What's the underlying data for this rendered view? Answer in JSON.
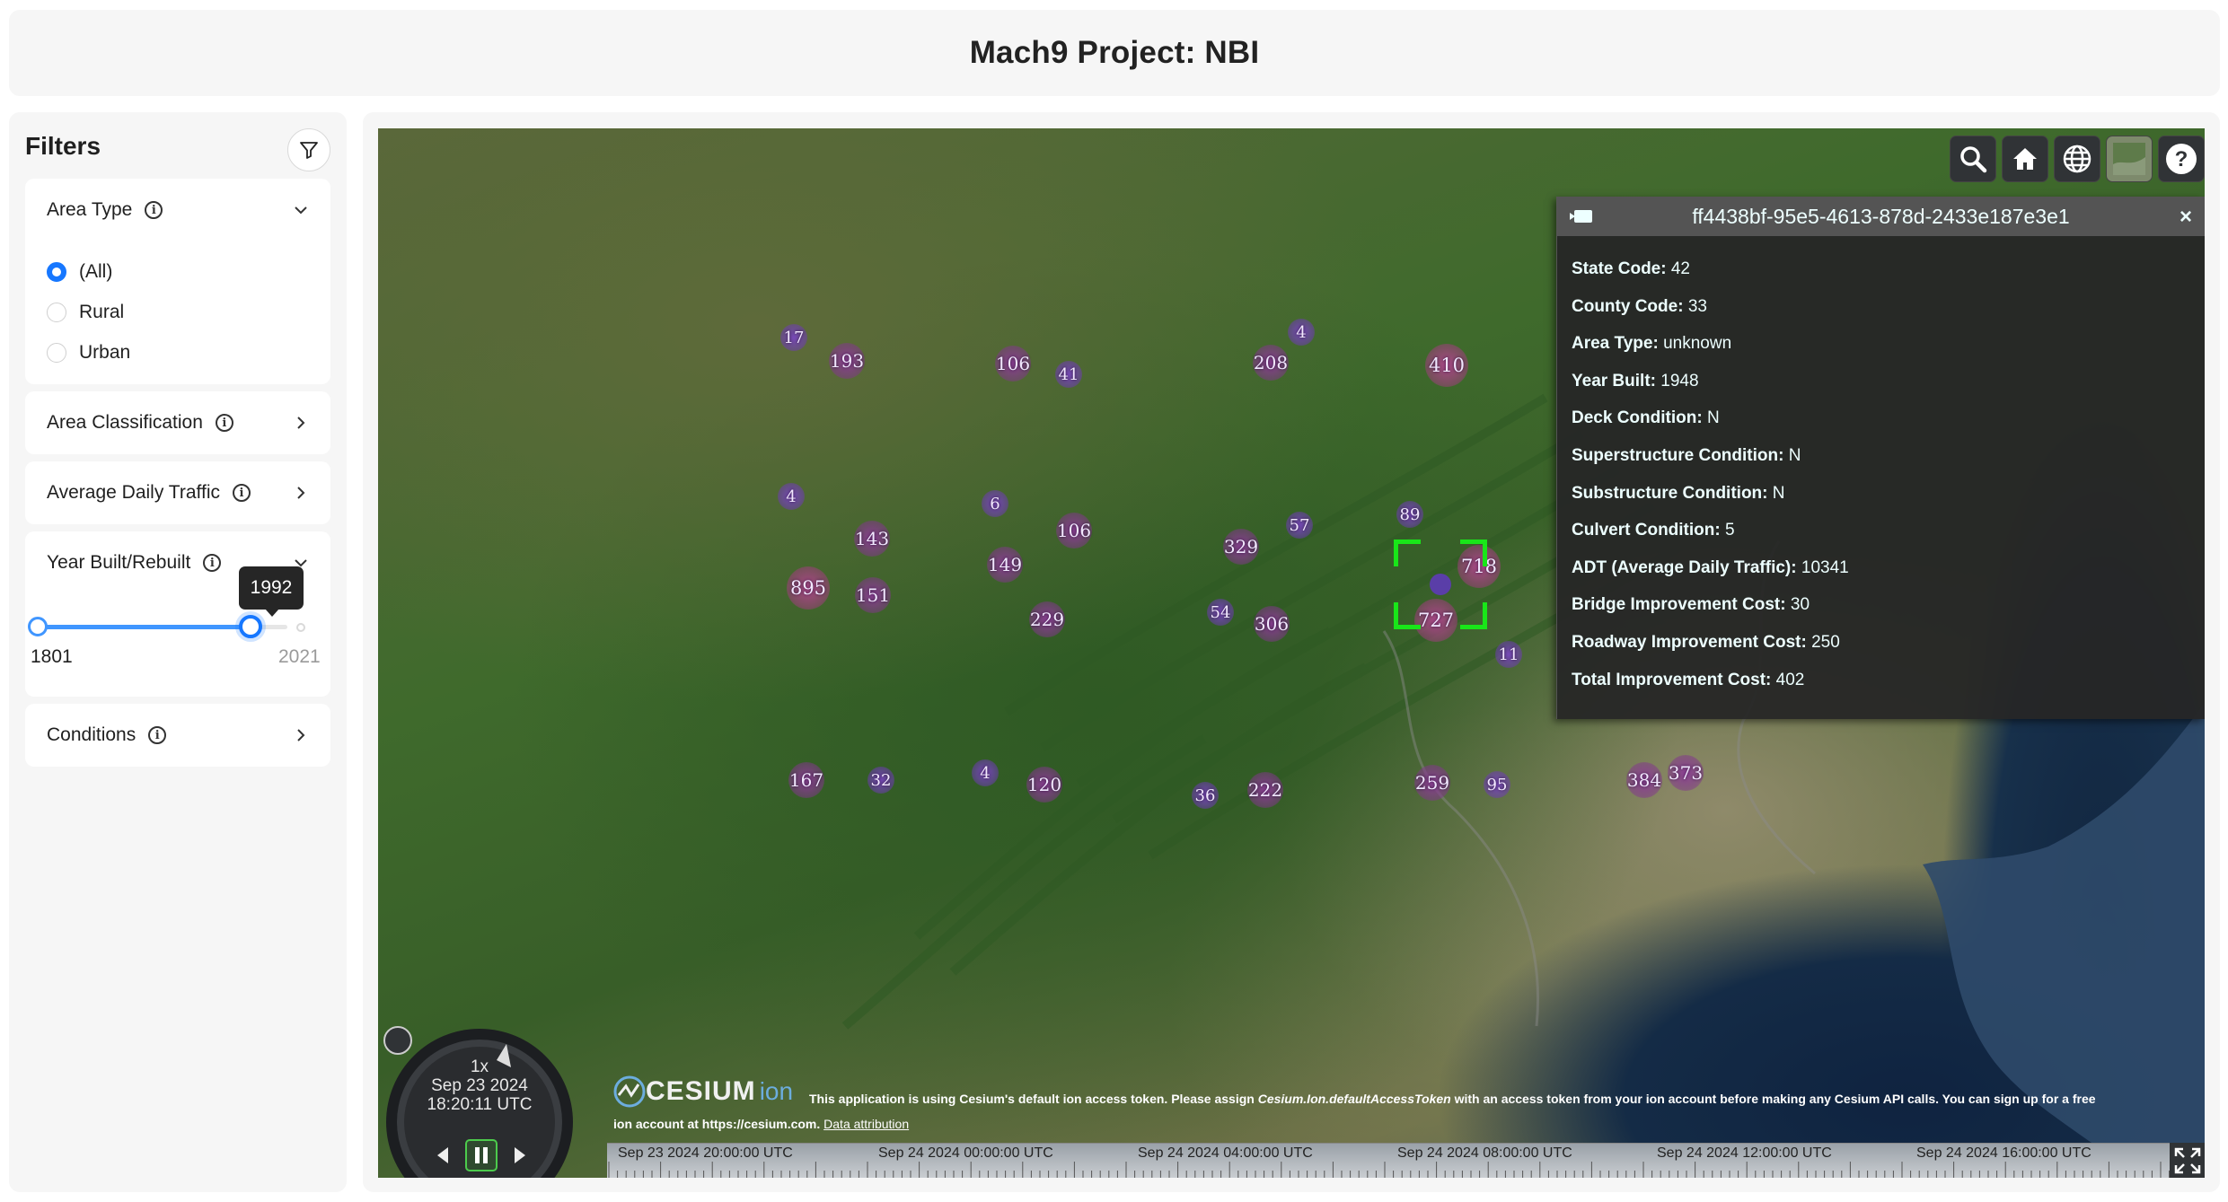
{
  "header": {
    "title": "Mach9 Project: NBI"
  },
  "sidebar": {
    "title": "Filters",
    "area_type": {
      "label": "Area Type",
      "options": [
        "(All)",
        "Rural",
        "Urban"
      ],
      "selected": "(All)"
    },
    "area_classification": {
      "label": "Area Classification"
    },
    "average_daily_traffic": {
      "label": "Average Daily Traffic"
    },
    "year_built": {
      "label": "Year Built/Rebuilt",
      "min": "1801",
      "max": "2021",
      "value": "1992"
    },
    "conditions": {
      "label": "Conditions"
    }
  },
  "map": {
    "clusters": [
      "17",
      "193",
      "106",
      "41",
      "208",
      "4",
      "410",
      "4",
      "6",
      "143",
      "106",
      "57",
      "89",
      "329",
      "895",
      "151",
      "149",
      "718",
      "229",
      "54",
      "306",
      "727",
      "11",
      "167",
      "32",
      "4",
      "120",
      "36",
      "222",
      "259",
      "95",
      "384",
      "373"
    ],
    "infobox": {
      "title": "ff4438bf-95e5-4613-878d-2433e187e3e1",
      "close": "×",
      "rows": [
        {
          "label": "State Code:",
          "value": "42"
        },
        {
          "label": "County Code:",
          "value": "33"
        },
        {
          "label": "Area Type:",
          "value": "unknown"
        },
        {
          "label": "Year Built:",
          "value": "1948"
        },
        {
          "label": "Deck Condition:",
          "value": "N"
        },
        {
          "label": "Superstructure Condition:",
          "value": "N"
        },
        {
          "label": "Substructure Condition:",
          "value": "N"
        },
        {
          "label": "Culvert Condition:",
          "value": "5"
        },
        {
          "label": "ADT (Average Daily Traffic):",
          "value": "10341"
        },
        {
          "label": "Bridge Improvement Cost:",
          "value": "30"
        },
        {
          "label": "Roadway Improvement Cost:",
          "value": "250"
        },
        {
          "label": "Total Improvement Cost:",
          "value": "402"
        }
      ]
    },
    "animation": {
      "speed": "1x",
      "date": "Sep 23 2024",
      "time": "18:20:11 UTC"
    },
    "credits": {
      "logo_word": "CESIUM",
      "logo_ion": "ion",
      "line1_a": "This application is using Cesium's default ion access token. Please assign ",
      "line1_code": "Cesium.Ion.defaultAccessToken",
      "line1_b": " with an access token from your ion account before making any Cesium API calls. You can sign up for a free",
      "line2": "ion account at https://cesium.com.",
      "data_attribution": "Data attribution"
    },
    "timeline": {
      "labels": [
        "Sep 23 2024 20:00:00 UTC",
        "Sep 24 2024 00:00:00 UTC",
        "Sep 24 2024 04:00:00 UTC",
        "Sep 24 2024 08:00:00 UTC",
        "Sep 24 2024 12:00:00 UTC",
        "Sep 24 2024 16:00:00 UTC"
      ]
    },
    "toolbar_icons": [
      "search-icon",
      "home-icon",
      "globe-icon",
      "layers-icon",
      "help-icon"
    ]
  },
  "colors": {
    "accent": "#1677ff",
    "selection": "#19e619",
    "cluster_small": "#7846be",
    "cluster_large": "#af468c"
  }
}
